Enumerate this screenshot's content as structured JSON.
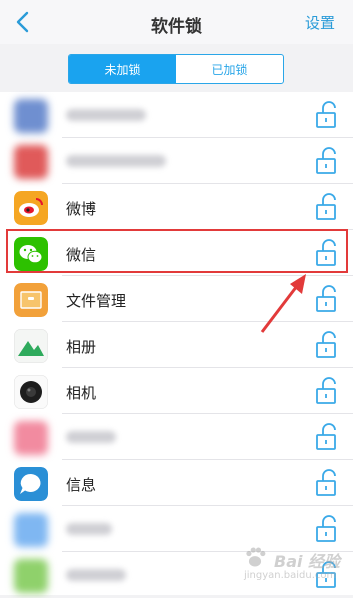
{
  "header": {
    "title": "软件锁",
    "settings_label": "设置"
  },
  "tabs": [
    {
      "label": "未加锁",
      "active": true
    },
    {
      "label": "已加锁",
      "active": false
    }
  ],
  "apps": [
    {
      "label": "",
      "icon": "blurred-app-icon",
      "color": "#6f8fd0",
      "blurred": true
    },
    {
      "label": "",
      "icon": "blurred-app-icon",
      "color": "#e05a5a",
      "blurred": true
    },
    {
      "label": "微博",
      "icon": "weibo-icon",
      "color": "#f5a623",
      "blurred": false
    },
    {
      "label": "微信",
      "icon": "wechat-icon",
      "color": "#2dc100",
      "blurred": false
    },
    {
      "label": "文件管理",
      "icon": "folder-icon",
      "color": "#f2a13a",
      "blurred": false
    },
    {
      "label": "相册",
      "icon": "photos-icon",
      "color": "#2eaa5c",
      "blurred": false
    },
    {
      "label": "相机",
      "icon": "camera-icon",
      "color": "#222222",
      "blurred": false
    },
    {
      "label": "",
      "icon": "blurred-app-icon",
      "color": "#f28ba0",
      "blurred": true
    },
    {
      "label": "信息",
      "icon": "messages-icon",
      "color": "#2a8fd6",
      "blurred": false
    },
    {
      "label": "",
      "icon": "blurred-app-icon",
      "color": "#7fb7f2",
      "blurred": true
    },
    {
      "label": "",
      "icon": "blurred-app-icon",
      "color": "#8fd16b",
      "blurred": true
    }
  ],
  "watermark": {
    "text": "Bai 经验",
    "sub": "jingyan.baidu.com"
  },
  "colors": {
    "accent": "#1aa3ef",
    "highlight": "#e23a3a"
  }
}
